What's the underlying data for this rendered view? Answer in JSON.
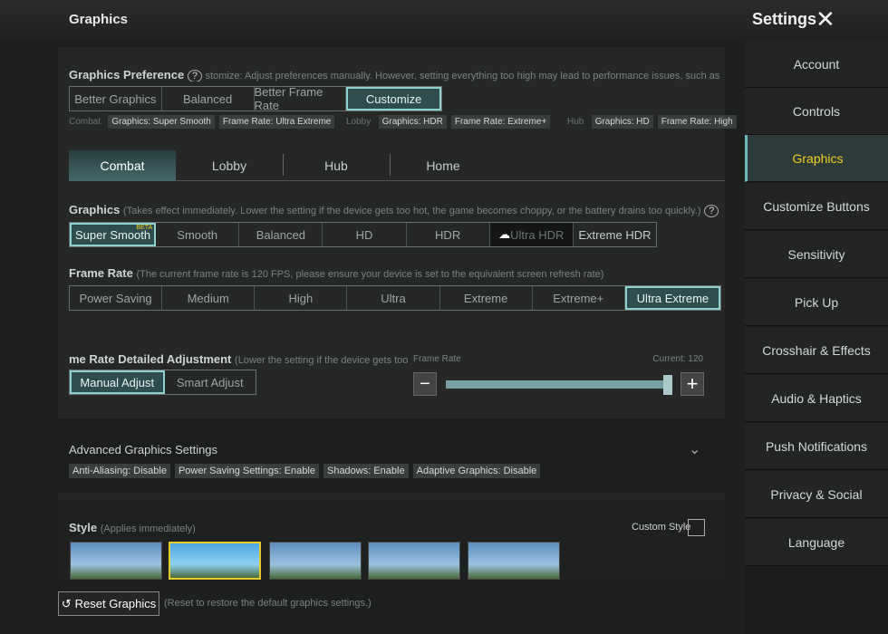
{
  "header": {
    "title": "Graphics",
    "settings": "Settings"
  },
  "sidebar": {
    "items": [
      {
        "label": "Account"
      },
      {
        "label": "Controls"
      },
      {
        "label": "Graphics"
      },
      {
        "label": "Customize Buttons"
      },
      {
        "label": "Sensitivity"
      },
      {
        "label": "Pick Up"
      },
      {
        "label": "Crosshair & Effects"
      },
      {
        "label": "Audio & Haptics"
      },
      {
        "label": "Push Notifications"
      },
      {
        "label": "Privacy & Social"
      },
      {
        "label": "Language"
      }
    ],
    "active": "Graphics"
  },
  "preference": {
    "label": "Graphics Preference",
    "help": "?",
    "desc": "stomize: Adjust preferences manually. However, setting everything too high may lead to performance issues, such as overheating, batte",
    "options": [
      "Better Graphics",
      "Balanced",
      "Better Frame Rate",
      "Customize"
    ],
    "selected": "Customize",
    "summary": {
      "combat_label": "Combat",
      "combat": [
        "Graphics: Super Smooth",
        "Frame Rate: Ultra Extreme"
      ],
      "lobby_label": "Lobby",
      "lobby": [
        "Graphics: HDR",
        "Frame Rate: Extreme+"
      ],
      "hub_label": "Hub",
      "hub": [
        "Graphics: HD",
        "Frame Rate: High"
      ]
    }
  },
  "tabs": [
    "Combat",
    "Lobby",
    "Hub",
    "Home"
  ],
  "active_tab": "Combat",
  "graphics": {
    "label": "Graphics",
    "desc": "(Takes effect immediately. Lower the setting if the device gets too hot, the game becomes choppy, or the battery drains too quickly.)",
    "help": "?",
    "options": [
      "Super Smooth",
      "Smooth",
      "Balanced",
      "HD",
      "HDR",
      "Ultra HDR",
      "Extreme HDR"
    ],
    "selected": "Super Smooth",
    "beta": "BETA"
  },
  "frame_rate": {
    "label": "Frame Rate",
    "desc": "(The current frame rate is 120 FPS, please ensure your device is set to the equivalent screen refresh rate)",
    "options": [
      "Power Saving",
      "Medium",
      "High",
      "Ultra",
      "Extreme",
      "Extreme+",
      "Ultra Extreme"
    ],
    "selected": "Ultra Extreme"
  },
  "adjust": {
    "label": "me Rate Detailed Adjustment",
    "desc": "(Lower the setting if the device gets too hot, the gam",
    "options": [
      "Manual Adjust",
      "Smart Adjust"
    ],
    "selected": "Manual Adjust",
    "slider_label": "Frame Rate",
    "current": "Current: 120",
    "value": 120,
    "fill_percent": 100
  },
  "advanced": {
    "label": "Advanced Graphics Settings",
    "chips": [
      "Anti-Aliasing: Disable",
      "Power Saving Settings: Enable",
      "Shadows: Enable",
      "Adaptive Graphics: Disable"
    ]
  },
  "style": {
    "label": "Style",
    "desc": "(Applies immediately)",
    "custom": "Custom Style",
    "selected_index": 1
  },
  "reset": {
    "label": "Reset Graphics",
    "desc": "(Reset to restore the default graphics settings.)"
  }
}
